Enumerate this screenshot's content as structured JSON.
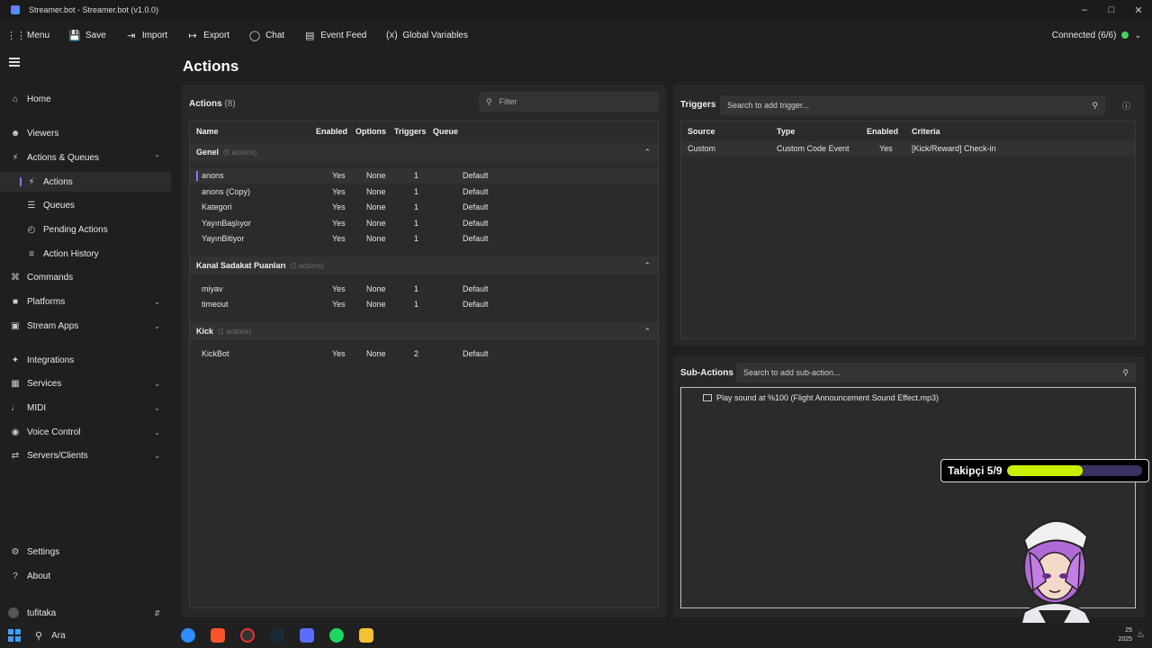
{
  "window": {
    "title": "Streamer.bot - Streamer.bot (v1.0.0)"
  },
  "toolbar": {
    "menu": "Menu",
    "save": "Save",
    "import": "Import",
    "export": "Export",
    "chat": "Chat",
    "event_feed": "Event Feed",
    "global_variables": "Global Variables",
    "connected": "Connected (6/6)",
    "connected_color": "#49d163"
  },
  "sidebar": {
    "home": "Home",
    "viewers": "Viewers",
    "actions_queues": "Actions & Queues",
    "actions": "Actions",
    "queues": "Queues",
    "pending_actions": "Pending Actions",
    "action_history": "Action History",
    "commands": "Commands",
    "platforms": "Platforms",
    "stream_apps": "Stream Apps",
    "integrations": "Integrations",
    "services": "Services",
    "midi": "MIDI",
    "voice_control": "Voice Control",
    "servers_clients": "Servers/Clients",
    "settings": "Settings",
    "about": "About",
    "user": "tufitaka"
  },
  "page": {
    "title": "Actions"
  },
  "actions_panel": {
    "title": "Actions",
    "count": "(8)",
    "filter_placeholder": "Filter",
    "columns": {
      "name": "Name",
      "enabled": "Enabled",
      "options": "Options",
      "triggers": "Triggers",
      "queue": "Queue"
    },
    "groups": [
      {
        "name": "Genel",
        "count": "(5 actions)",
        "rows": [
          {
            "name": "anons",
            "enabled": "Yes",
            "options": "None",
            "triggers": "1",
            "queue": "Default"
          },
          {
            "name": "anons (Copy)",
            "enabled": "Yes",
            "options": "None",
            "triggers": "1",
            "queue": "Default"
          },
          {
            "name": "Kategori",
            "enabled": "Yes",
            "options": "None",
            "triggers": "1",
            "queue": "Default"
          },
          {
            "name": "YayınBaşlıyor",
            "enabled": "Yes",
            "options": "None",
            "triggers": "1",
            "queue": "Default"
          },
          {
            "name": "YayınBitiyor",
            "enabled": "Yes",
            "options": "None",
            "triggers": "1",
            "queue": "Default"
          }
        ]
      },
      {
        "name": "Kanal Sadakat Puanları",
        "count": "(2 actions)",
        "rows": [
          {
            "name": "miyav",
            "enabled": "Yes",
            "options": "None",
            "triggers": "1",
            "queue": "Default"
          },
          {
            "name": "timeout",
            "enabled": "Yes",
            "options": "None",
            "triggers": "1",
            "queue": "Default"
          }
        ]
      },
      {
        "name": "Kick",
        "count": "(1 actions)",
        "rows": [
          {
            "name": "KickBot",
            "enabled": "Yes",
            "options": "None",
            "triggers": "2",
            "queue": "Default"
          }
        ]
      }
    ]
  },
  "triggers_panel": {
    "title": "Triggers",
    "search_placeholder": "Search to add trigger...",
    "columns": {
      "source": "Source",
      "type": "Type",
      "enabled": "Enabled",
      "criteria": "Criteria"
    },
    "rows": [
      {
        "source": "Custom",
        "type": "Custom Code Event",
        "enabled": "Yes",
        "criteria": "[Kick/Reward] Check-in"
      }
    ]
  },
  "subactions_panel": {
    "title": "Sub-Actions",
    "search_placeholder": "Search to add sub-action...",
    "items": [
      "Play sound at %100 (Flight Announcement Sound Effect.mp3)"
    ]
  },
  "overlay": {
    "follower_label": "Takipçi 5/9",
    "follower_progress": 0.56,
    "fill_color": "#c8f000"
  },
  "taskbar": {
    "search": "Ara",
    "clock_top": "25",
    "clock_bottom": "2025"
  }
}
